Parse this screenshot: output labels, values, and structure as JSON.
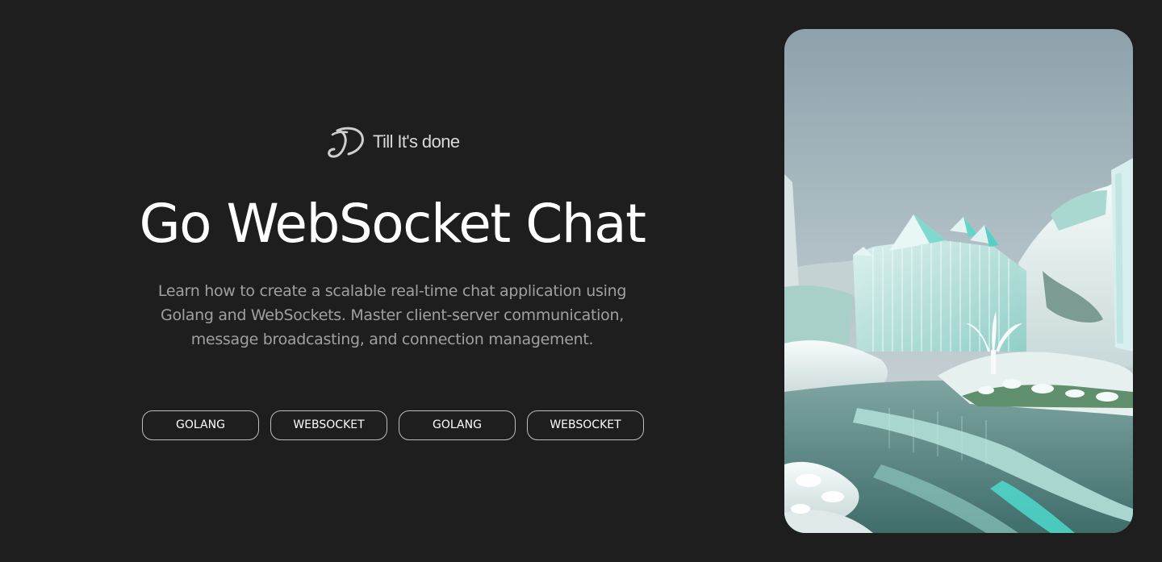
{
  "brand": {
    "name": "Till It's done",
    "logo_icon": "td-monogram-icon"
  },
  "hero": {
    "title": "Go WebSocket Chat",
    "description": "Learn how to create a scalable real-time chat application using Golang and WebSockets. Master client-server communication, message broadcasting, and connection management."
  },
  "tags": [
    {
      "label": "GOLANG"
    },
    {
      "label": "WEBSOCKET"
    },
    {
      "label": "GOLANG"
    },
    {
      "label": "WEBSOCKET"
    }
  ],
  "image": {
    "subject": "icy crystal palace landscape",
    "colors": {
      "sky_top": "#8fa3ad",
      "sky_bottom": "#c9d3d6",
      "ice": "#e9f2f1",
      "glass": "#9fd6cf",
      "water": "#5e8e8a",
      "turquoise": "#4fe0d2"
    }
  },
  "colors": {
    "background": "#1e1e1e",
    "title": "#ffffff",
    "description": "#a0a0a0",
    "tag_border": "#bdbdbd"
  }
}
